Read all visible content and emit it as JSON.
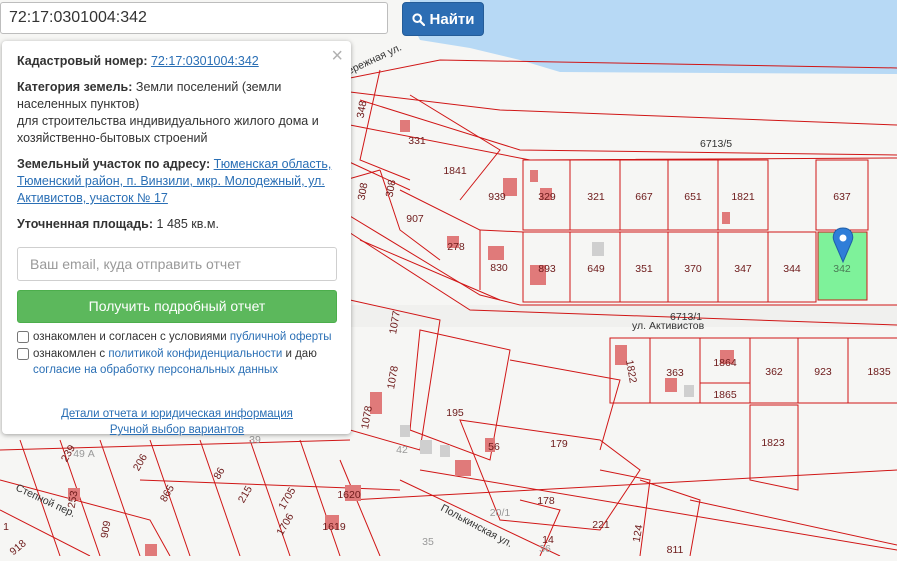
{
  "search": {
    "value": "72:17:0301004:342",
    "button_label": "Найти"
  },
  "popup": {
    "cadastral_label": "Кадастровый номер:",
    "cadastral_value": "72:17:0301004:342",
    "category_label": "Категория земель:",
    "category_value": "Земли поселений (земли населенных пунктов)",
    "category_use": "для строительства индивидуального жилого дома и хозяйственно-бытовых строений",
    "address_label": "Земельный участок по адресу:",
    "address_value": "Тюменская область, Тюменский район, п. Винзили, мкр. Молодежный, ул. Активистов, участок № 17",
    "area_label": "Уточненная площадь:",
    "area_value": "1 485 кв.м.",
    "email_placeholder": "Ваш email, куда отправить отчет",
    "report_button": "Получить подробный отчет",
    "check1_text": "ознакомлен и согласен с условиями ",
    "check1_link": "публичной оферты",
    "check2_text": "ознакомлен с ",
    "check2_link": "политикой конфиденциальности",
    "check2_text2": " и даю ",
    "check2_link2": "согласие на обработку персональных данных",
    "details_link": "Детали отчета и юридическая информация",
    "manual_link": "Ручной выбор вариантов"
  },
  "map": {
    "selected_parcel": "342",
    "colors": {
      "boundary": "#d01616",
      "water": "#b7d9f5",
      "building": "#e07a7a",
      "selected": "#7ef29a",
      "marker": "#2f7ed8"
    },
    "streets": [
      "бережная ул.",
      "6713/5",
      "6713/1",
      "ул. Активистов",
      "Степной пер.",
      "Полькинская ул."
    ],
    "parcels_row1": [
      "939",
      "329",
      "321",
      "667",
      "651",
      "1821",
      "637"
    ],
    "parcels_row2": [
      "830",
      "893",
      "649",
      "351",
      "370",
      "347",
      "344",
      "342"
    ],
    "parcels_south": [
      "1822",
      "363",
      "1864",
      "1865",
      "362",
      "923",
      "1835",
      "1823"
    ],
    "parcels_west": [
      "348",
      "331",
      "1841",
      "308",
      "308",
      "907",
      "278",
      "1077",
      "1078",
      "1078",
      "195",
      "56",
      "179",
      "178",
      "221",
      "124",
      "811"
    ],
    "parcels_bottom": [
      "239",
      "49 А",
      "206",
      "86",
      "215",
      "1705",
      "865",
      "1706",
      "1620",
      "1619",
      "253",
      "909",
      "918",
      "39",
      "42",
      "20/1",
      "14",
      "35",
      "1",
      "36"
    ]
  }
}
